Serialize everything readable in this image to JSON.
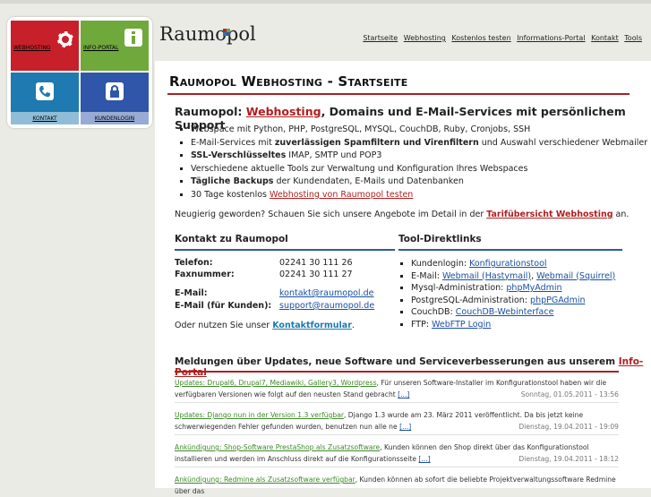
{
  "tiles": {
    "webhosting": "WEBHOSTING",
    "info": "INFO-PORTAL",
    "kontakt": "KONTAKT",
    "kunden": "KUNDENLOGIN"
  },
  "logo": "Raumopol",
  "topnav": [
    "Startseite",
    "Webhosting",
    "Kostenlos testen",
    "Informations-Portal",
    "Kontakt",
    "Tools"
  ],
  "page_title": "Raumopol Webhosting - Startseite",
  "lead": {
    "prefix": "Raumopol: ",
    "link": "Webhosting",
    "suffix": ", Domains und E-Mail-Services mit persönlichem Support"
  },
  "features": [
    {
      "plain": "Webspace mit Python, PHP, PostgreSQL, MYSQL, CouchDB, Ruby, Cronjobs, SSH"
    },
    {
      "pre": "E-Mail-Services mit ",
      "bold": "zuverlässigen Spamfiltern und Virenfiltern",
      "post": " und Auswahl verschiedener Webmailer"
    },
    {
      "bold": "SSL-Verschlüsseltes",
      "post": " IMAP, SMTP und POP3"
    },
    {
      "plain": "Verschiedene aktuelle Tools zur Verwaltung und Konfiguration Ihres Webspaces"
    },
    {
      "bold": "Tägliche Backups",
      "post": " der Kundendaten, E-Mails und Datenbanken"
    },
    {
      "pre": "30 Tage kostenlos ",
      "link": "Webhosting von Raumopol testen"
    }
  ],
  "teaser": {
    "text": "Neugierig geworden? Schauen Sie sich unsere Angebote im Detail in der ",
    "link": "Tarifübersicht Webhosting",
    "suffix": " an."
  },
  "contact": {
    "title": "Kontakt zu Raumopol",
    "telefon_label": "Telefon:",
    "telefon": "02241 30 111 26",
    "fax_label": "Faxnummer:",
    "fax": "02241 30 111 27",
    "email_label": "E-Mail:",
    "email": "kontakt@raumopol.de",
    "email_kunden_label": "E-Mail (für Kunden):",
    "email_kunden": "support@raumopol.de",
    "form_pre": "Oder nutzen Sie unser ",
    "form_link": "Kontaktformular",
    "form_post": "."
  },
  "tools": {
    "title": "Tool-Direktlinks",
    "items": [
      {
        "label": "Kundenlogin: ",
        "links": [
          "Konfigurationstool"
        ]
      },
      {
        "label": "E-Mail: ",
        "links": [
          "Webmail (Hastymail)",
          "Webmail (Squirrel)"
        ]
      },
      {
        "label": "Mysql-Administration: ",
        "links": [
          "phpMyAdmin"
        ]
      },
      {
        "label": "PostgreSQL-Administration: ",
        "links": [
          "phpPGAdmin"
        ]
      },
      {
        "label": "CouchDB: ",
        "links": [
          "CouchDB-Webinterface"
        ]
      },
      {
        "label": "FTP: ",
        "links": [
          "WebFTP Login"
        ]
      }
    ]
  },
  "news": {
    "title": "Meldungen über Updates, neue Software und Serviceverbesserungen aus unserem ",
    "title_link": "Info-Portal",
    "items": [
      {
        "title": "Updates: Drupal6, Drupal7, Mediawiki, Gallery3, Wordpress",
        "text": ", Für unseren Software-Installer im Konfigurationstool haben wir die verfügbaren Versionen wie folgt auf den neusten Stand gebracht ",
        "more": "[...]",
        "date": "Sonntag, 01.05.2011 - 13:56"
      },
      {
        "title": "Updates: Django nun in der Version 1.3 verfügbar",
        "text": ", Django 1.3 wurde am 23. März 2011 veröffentlicht. Da bis jetzt keine schwerwiegenden Fehler gefunden wurden, benutzen nun alle ne ",
        "more": "[...]",
        "date": "Dienstag, 19.04.2011 - 19:09"
      },
      {
        "title": "Ankündigung: Shop-Software PrestaShop als Zusatzsoftware",
        "text": ", Kunden können den Shop direkt über das Konfigurationstool installieren und werden im Anschluss direkt auf die Konfigurationsseite ",
        "more": "[...]",
        "date": "Dienstag, 19.04.2011 - 18:12"
      },
      {
        "title": "Ankündigung: Redmine als Zusatzsoftware verfügbar",
        "text": ", Kunden können ab sofort die beliebte Projektverwaltungssoftware Redmine über das",
        "more": "",
        "date": ""
      }
    ]
  },
  "colors": {
    "red": "#c8202a",
    "green": "#6fa83b",
    "teal": "#1e7ab0",
    "blue": "#2f56a8",
    "accent": "#b01e1e"
  }
}
